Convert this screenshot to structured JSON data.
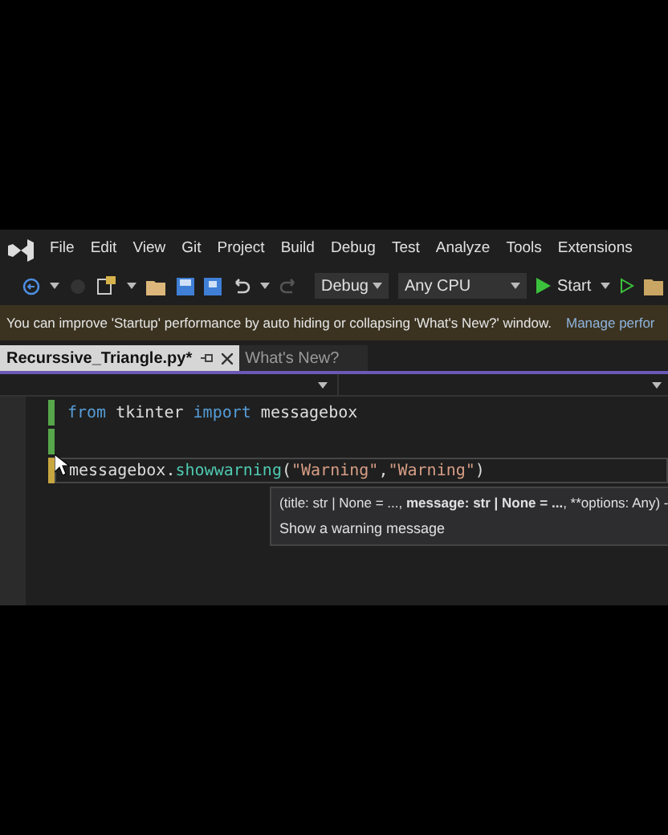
{
  "menu": [
    "File",
    "Edit",
    "View",
    "Git",
    "Project",
    "Build",
    "Debug",
    "Test",
    "Analyze",
    "Tools",
    "Extensions"
  ],
  "toolbar": {
    "configuration": "Debug",
    "platform": "Any CPU",
    "start": "Start"
  },
  "info_bar": {
    "message": "You can improve 'Startup' performance by auto hiding or collapsing 'What's New?' window.",
    "link": "Manage perfor"
  },
  "tabs": [
    {
      "label": "Recurssive_Triangle.py*",
      "selected": true
    },
    {
      "label": "What's New?",
      "selected": false
    }
  ],
  "code_lines": [
    {
      "saved": true,
      "current": false,
      "tokens": [
        {
          "kind": "keyword",
          "text": "from"
        },
        {
          "kind": "plain",
          "text": " tkinter "
        },
        {
          "kind": "keyword",
          "text": "import"
        },
        {
          "kind": "plain",
          "text": " messagebox"
        }
      ]
    },
    {
      "saved": true,
      "current": false
    },
    {
      "saved": false,
      "current": true,
      "tokens": [
        {
          "kind": "plain",
          "text": "messagebox."
        },
        {
          "kind": "function",
          "text": "showwarning"
        },
        {
          "kind": "plain",
          "text": "("
        },
        {
          "kind": "string",
          "text": "\"Warning\""
        },
        {
          "kind": "plain",
          "text": ","
        },
        {
          "kind": "string",
          "text": "\"Warning\""
        },
        {
          "kind": "plain",
          "text": ")"
        }
      ]
    }
  ],
  "tooltip": {
    "signature": [
      {
        "text": "(title: str | None = ..., ",
        "bold": false
      },
      {
        "text": "message: str | None = ...",
        "bold": true
      },
      {
        "text": ", **options: Any) -",
        "bold": false
      }
    ],
    "description": "Show a warning message"
  }
}
